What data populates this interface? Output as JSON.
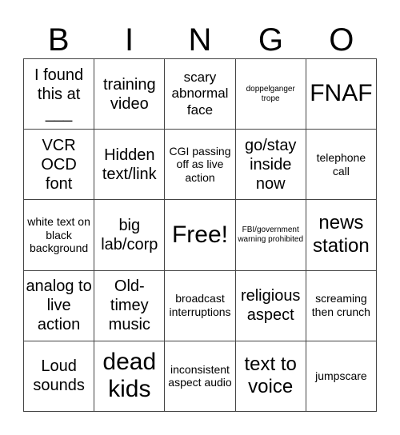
{
  "header": {
    "letters": [
      "B",
      "I",
      "N",
      "G",
      "O"
    ]
  },
  "board": {
    "cells": [
      "I found this at ___",
      "training video",
      "scary abnormal face",
      "doppelganger trope",
      "FNAF",
      "VCR OCD font",
      "Hidden text/link",
      "CGI passing off as live action",
      "go/stay inside now",
      "telephone call",
      "white text on black background",
      "big lab/corp",
      "Free!",
      "FBI/government warning prohibited",
      "news station",
      "analog to live action",
      "Old-timey music",
      "broadcast interruptions",
      "religious aspect",
      "screaming then crunch",
      "Loud sounds",
      "dead kids",
      "inconsistent aspect audio",
      "text to voice",
      "jumpscare"
    ],
    "free_space_index": 12
  }
}
